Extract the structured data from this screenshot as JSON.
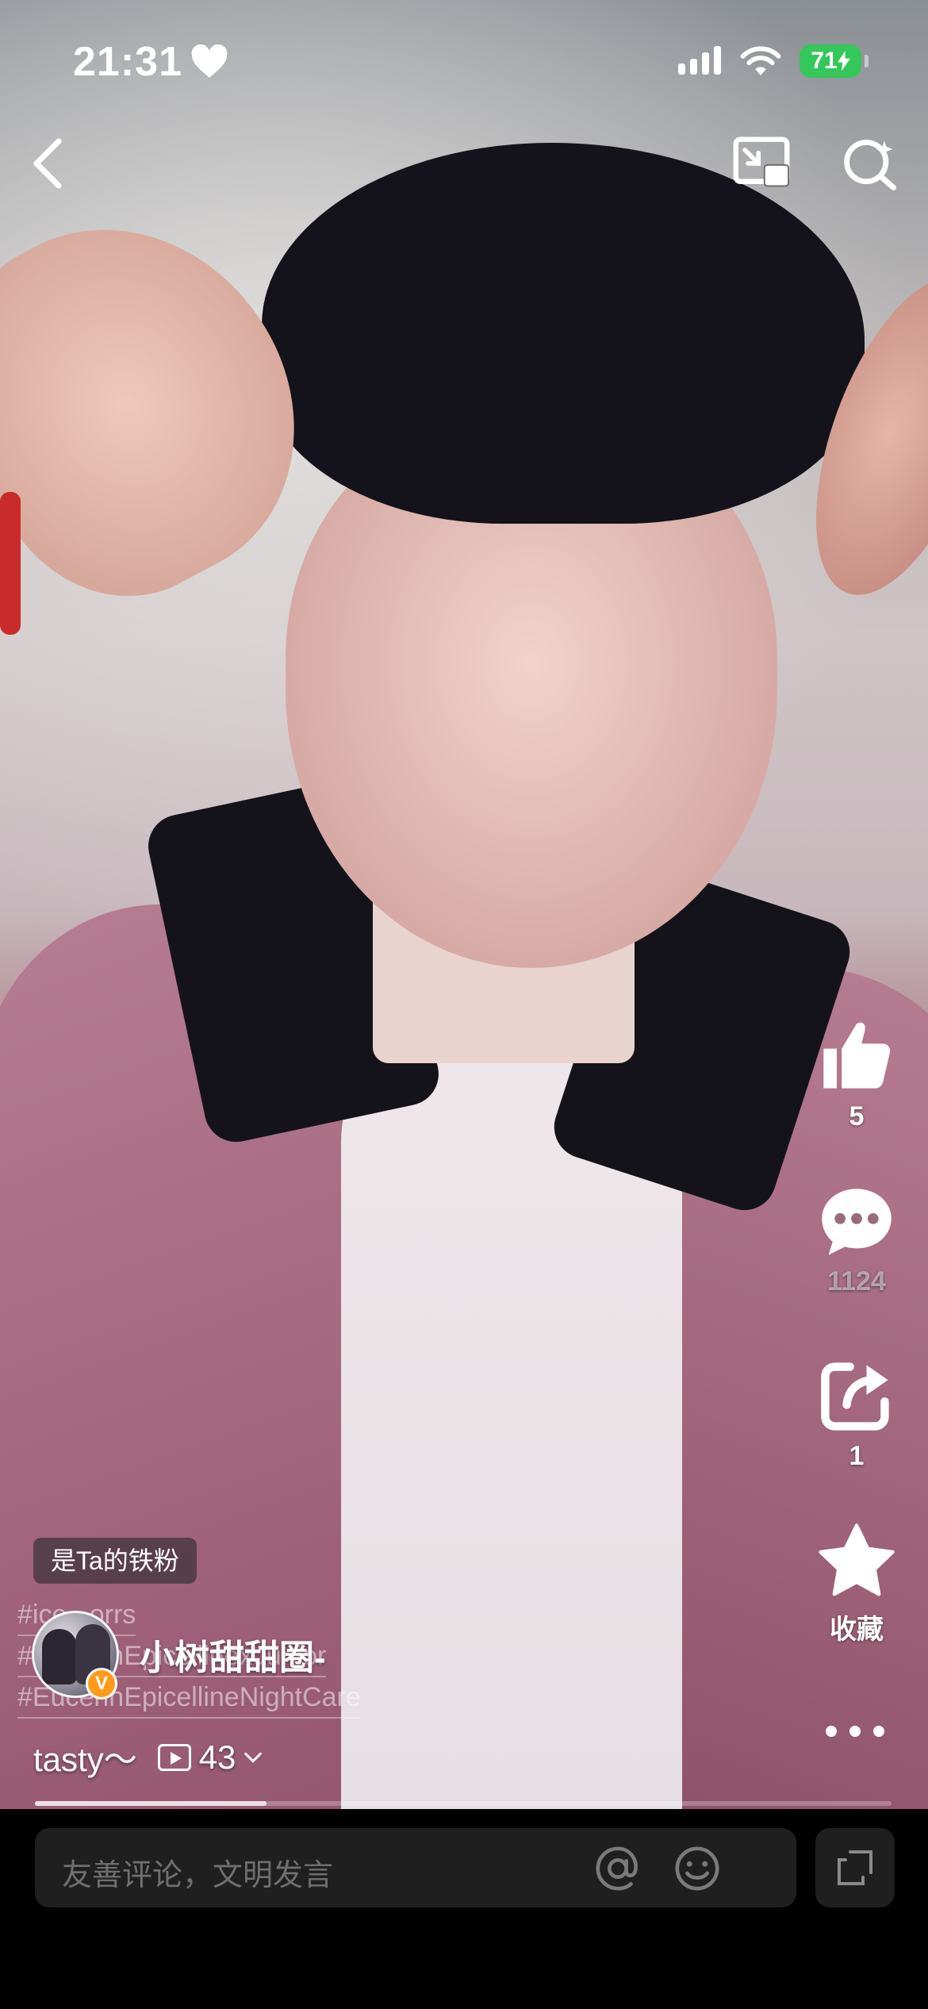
{
  "status_bar": {
    "time": "21:31",
    "battery": "71"
  },
  "top_bar": {
    "icons": [
      "back-icon",
      "picture-in-picture-icon",
      "search-icon"
    ]
  },
  "actions": {
    "like": {
      "count": "5"
    },
    "comment": {
      "count": "1124"
    },
    "share": {
      "count": "1"
    },
    "favorite": {
      "label": "收藏"
    }
  },
  "video": {
    "fan_badge": "是Ta的铁粉",
    "author": "小树甜甜圈-",
    "verified_mark": "V",
    "hashtags": [
      "#ice...orrs",
      "#EucerinEpicellinexJunior",
      "#EucerinEpicellineNightCare"
    ],
    "caption": "tasty～",
    "views": "43",
    "progress": 0.27
  },
  "comment_bar": {
    "placeholder": "友善评论，文明发言"
  },
  "colors": {
    "battery": "#34c759",
    "verified": "#ff9a1a",
    "input_bg": "#1f1f1f"
  }
}
